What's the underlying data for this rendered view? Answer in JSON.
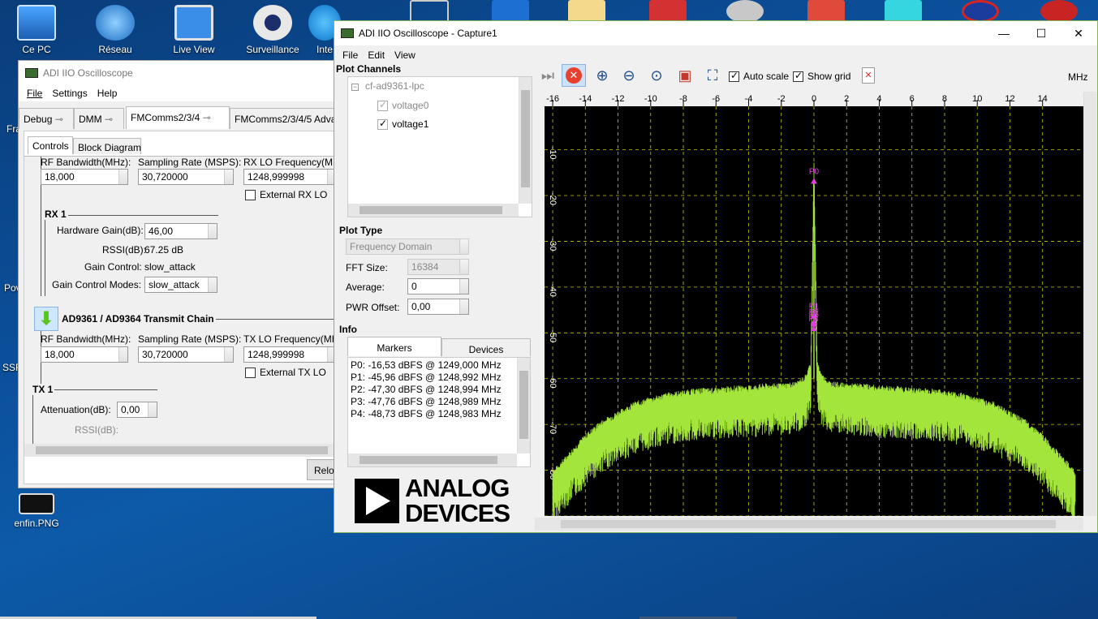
{
  "desktop": {
    "icons": [
      {
        "label": "Ce PC"
      },
      {
        "label": "Réseau"
      },
      {
        "label": "Live View"
      },
      {
        "label": "Surveillance"
      },
      {
        "label": "Inte"
      }
    ],
    "edge_labels": [
      "Fra",
      "Pov",
      "SSF"
    ],
    "file_icon_label": "enfin.PNG"
  },
  "win1": {
    "title": "ADI IIO Oscilloscope",
    "menu": [
      "File",
      "Settings",
      "Help"
    ],
    "tabs": [
      "Debug",
      "DMM",
      "FMComms2/3/4",
      "FMComms2/3/4/5 Adva"
    ],
    "subtabs": [
      "Controls",
      "Block Diagram"
    ],
    "rx": {
      "rf_bw_label": "RF Bandwidth(MHz):",
      "rf_bw": "18,000",
      "samp_label": "Sampling Rate (MSPS):",
      "samp": "30,720000",
      "lo_label": "RX LO Frequency(MH",
      "lo": "1248,999998",
      "ext_lo": "External RX LO",
      "group": "RX 1",
      "gain_label": "Hardware Gain(dB):",
      "gain": "46,00",
      "rssi_label": "RSSI(dB):",
      "rssi": "67.25 dB",
      "gc_label": "Gain Control:",
      "gc": "slow_attack",
      "gcm_label": "Gain Control Modes:",
      "gcm": "slow_attack"
    },
    "tx": {
      "chain_title": "AD9361 / AD9364 Transmit Chain",
      "rf_bw_label": "RF Bandwidth(MHz):",
      "rf_bw": "18,000",
      "samp_label": "Sampling Rate (MSPS):",
      "samp": "30,720000",
      "lo_label": "TX LO Frequency(MH",
      "lo": "1248,999998",
      "ext_lo": "External TX LO",
      "group": "TX 1",
      "atten_label": "Attenuation(dB):",
      "atten": "0,00",
      "rssi_label": "RSSI(dB):"
    },
    "reload": "Reloa"
  },
  "win2": {
    "title": "ADI IIO Oscilloscope - Capture1",
    "menu": [
      "File",
      "Edit",
      "View"
    ],
    "plot_channels_title": "Plot Channels",
    "device": "cf-ad9361-lpc",
    "channels": [
      "voltage0",
      "voltage1"
    ],
    "plot_type_title": "Plot Type",
    "plot_type": "Frequency Domain",
    "fft_label": "FFT Size:",
    "fft": "16384",
    "avg_label": "Average:",
    "avg": "0",
    "pwr_label": "PWR Offset:",
    "pwr": "0,00",
    "info_title": "Info",
    "info_tabs": [
      "Markers",
      "Devices"
    ],
    "markers": [
      "P0: -16,53 dBFS @ 1249,000 MHz",
      "P1: -45,96 dBFS @ 1248,992 MHz",
      "P2: -47,30 dBFS @ 1248,994 MHz",
      "P3: -47,76 dBFS @ 1248,989 MHz",
      "P4: -48,73 dBFS @ 1248,983 MHz"
    ],
    "toolbar": {
      "auto_scale": "Auto scale",
      "show_grid": "Show grid",
      "unit": "MHz"
    },
    "logo_line1": "ANALOG",
    "logo_line2": "DEVICES"
  },
  "chart_data": {
    "type": "line",
    "title": "",
    "xlabel": "MHz",
    "ylabel": "",
    "xlim": [
      -16.5,
      16.5
    ],
    "ylim": [
      -90,
      -0.5
    ],
    "x_ticks": [
      "-16",
      "-14",
      "-12",
      "-10",
      "-8",
      "-6",
      "-4",
      "-2",
      "0",
      "2",
      "4",
      "6",
      "8",
      "10",
      "12",
      "14"
    ],
    "y_ticks": [
      "-10",
      "-20",
      "-30",
      "-40",
      "-50",
      "-60",
      "-70",
      "-80",
      "-90"
    ],
    "grid": true,
    "series": [
      {
        "color": "#a4e53c",
        "x": [
          -16,
          -15,
          -14,
          -13,
          -12,
          -11,
          -10,
          -9,
          -8,
          -7,
          -6,
          -5,
          -4,
          -3,
          -2,
          -1,
          -0.5,
          -0.2,
          0,
          0.2,
          0.5,
          1,
          2,
          3,
          4,
          5,
          6,
          7,
          8,
          9,
          10,
          11,
          12,
          13,
          14,
          15,
          16
        ],
        "values": [
          -84,
          -80,
          -76,
          -73,
          -71,
          -69,
          -68,
          -67,
          -66.5,
          -66,
          -66,
          -65.5,
          -65.5,
          -65,
          -65,
          -64.5,
          -63,
          -60,
          -16.5,
          -60,
          -63,
          -64.5,
          -65,
          -65,
          -65.5,
          -65.5,
          -66,
          -66,
          -66.5,
          -67,
          -68,
          -69,
          -71,
          -73,
          -76,
          -80,
          -84
        ]
      }
    ],
    "markers": [
      {
        "name": "P0",
        "x": 0,
        "y": -16.53
      },
      {
        "name": "P1",
        "x": -0.008,
        "y": -45.96
      },
      {
        "name": "P2",
        "x": -0.006,
        "y": -47.3
      },
      {
        "name": "P3",
        "x": -0.011,
        "y": -47.76
      },
      {
        "name": "P4",
        "x": -0.017,
        "y": -48.73
      }
    ]
  }
}
